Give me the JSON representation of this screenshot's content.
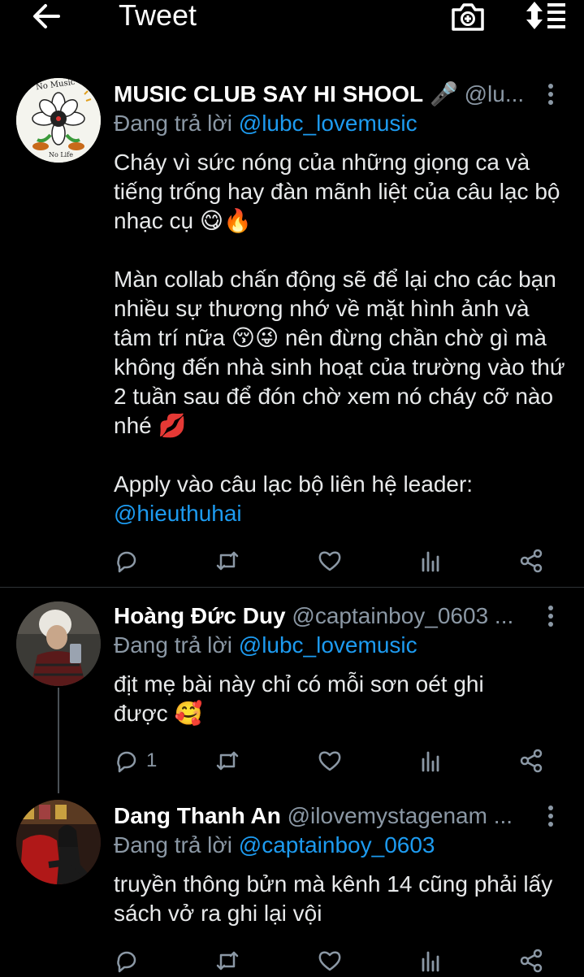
{
  "header": {
    "title": "Tweet",
    "back_icon": "arrow-left-icon",
    "camera_icon": "camera-plus-icon",
    "sort_icon": "sort-icon"
  },
  "tweets": [
    {
      "name": "MUSIC CLUB SAY HI SHOOL",
      "name_suffix": "🎤",
      "handle": "@lu...",
      "replying_prefix": "Đang trả lời ",
      "replying_to": "@lubc_lovemusic",
      "paragraphs": [
        "Cháy vì sức nóng của những giọng ca và tiếng trống hay đàn mãnh liệt của câu lạc bộ nhạc cụ 😋🔥",
        "Màn collab chấn động sẽ để lại cho các bạn nhiều sự thương nhớ về mặt hình ảnh và tâm trí nữa 😚😜 nên đừng chần chờ gì mà không đến nhà sinh hoạt của trường vào thứ 2 tuần sau để đón chờ xem nó cháy cỡ nào nhé 💋",
        "Apply vào câu lạc bộ liên hệ leader:"
      ],
      "mention_line": "@hieuthuhai",
      "reply_count": "",
      "avatar_text_top": "No Music",
      "avatar_text_bottom": "No Life"
    },
    {
      "name": "Hoàng Đức Duy",
      "handle": "@captainboy_0603 ...",
      "replying_prefix": "Đang trả lời ",
      "replying_to": "@lubc_lovemusic",
      "paragraphs": [
        "địt mẹ bài này chỉ có mỗi sơn oét ghi được 🥰"
      ],
      "reply_count": "1"
    },
    {
      "name": "Dang Thanh An",
      "handle": "@ilovemystagenam ...",
      "replying_prefix": "Đang trả lời ",
      "replying_to": "@captainboy_0603",
      "paragraphs": [
        "truyền thông bửn mà kênh 14 cũng phải lấy sách vở ra ghi lại vội"
      ],
      "reply_count": ""
    }
  ],
  "action_icons": [
    "reply-icon",
    "retweet-icon",
    "like-icon",
    "views-icon",
    "share-icon"
  ],
  "colors": {
    "background": "#000000",
    "text": "#e7e9ea",
    "secondary": "#8b98a5",
    "accent": "#1d9bf0",
    "divider": "#2f3336"
  }
}
